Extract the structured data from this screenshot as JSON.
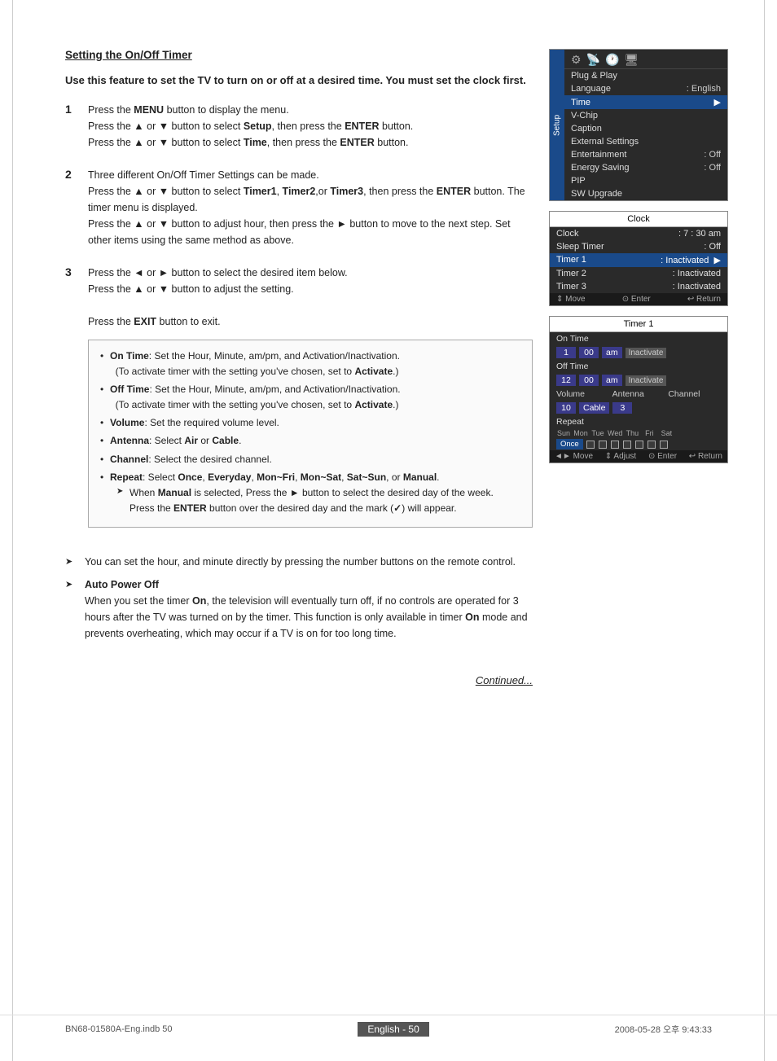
{
  "page": {
    "title": "Setting the On/Off Timer",
    "intro": "Use this feature to set the TV to turn on or off at a desired time. You must set the clock first.",
    "steps": [
      {
        "number": "1",
        "content": "Press the <b>MENU</b> button to display the menu.<br>Press the ▲ or ▼ button to select <b>Setup</b>, then press the <b>ENTER</b> button.<br>Press the ▲ or ▼ button to select <b>Time</b>, then press the <b>ENTER</b> button."
      },
      {
        "number": "2",
        "content": "Three different On/Off Timer Settings can be made.<br>Press the ▲ or ▼ button to select <b>Timer1</b>, <b>Timer2</b>, or <b>Timer3</b>, then press the <b>ENTER</b> button. The timer menu is displayed.<br>Press the ▲ or ▼ button to adjust hour, then press the ► button to move to the next step. Set other items using the same method as above."
      },
      {
        "number": "3",
        "content": "Press the ◄ or ► button to select the desired item below.<br>Press the ▲ or ▼ button to adjust the setting.<br><br>Press the <b>EXIT</b> button to exit."
      }
    ],
    "infobox": {
      "items": [
        "On Time: Set the Hour, Minute, am/pm, and Activation/Inactivation. (To activate timer with the setting you've chosen, set to Activate.)",
        "Off Time: Set the Hour, Minute, am/pm, and Activation/Inactivation. (To activate timer with the setting you've chosen, set to Activate.)",
        "Volume: Set the required volume level.",
        "Antenna: Select Air or Cable.",
        "Channel: Select the desired channel.",
        "Repeat: Select Once, Everyday, Mon~Fri, Mon~Sat, Sat~Sun, or Manual."
      ],
      "subItem": "When Manual is selected, Press the ► button to select the desired day of the week. Press the ENTER button over the desired day and the mark (✓) will appear."
    },
    "notes": [
      "You can set the hour, and minute directly by pressing the number buttons on the remote control.",
      "Auto Power Off\nWhen you set the timer On, the television will eventually turn off, if no controls are operated for 3 hours after the TV was turned on by the timer. This function is only available in timer On mode and prevents overheating, which may occur if a TV is on for too long time."
    ],
    "continued": "Continued...",
    "footer": {
      "file": "BN68-01580A-Eng.indb   50",
      "date": "2008-05-28   오후 9:43:33",
      "page_label": "English - 50"
    }
  },
  "menus": {
    "setup_menu": {
      "title": "Setup",
      "items": [
        {
          "label": "Plug & Play",
          "value": ""
        },
        {
          "label": "Language",
          "value": ": English"
        },
        {
          "label": "Time",
          "value": "",
          "highlighted": true
        },
        {
          "label": "V-Chip",
          "value": ""
        },
        {
          "label": "Caption",
          "value": ""
        },
        {
          "label": "External Settings",
          "value": ""
        },
        {
          "label": "Entertainment",
          "value": ": Off"
        },
        {
          "label": "Energy Saving",
          "value": ": Off"
        },
        {
          "label": "PIP",
          "value": ""
        },
        {
          "label": "SW Upgrade",
          "value": ""
        }
      ]
    },
    "clock_menu": {
      "title": "Clock",
      "items": [
        {
          "label": "Clock",
          "value": ": 7 : 30 am"
        },
        {
          "label": "Sleep Timer",
          "value": ": Off"
        },
        {
          "label": "Timer 1",
          "value": ": Inactivated",
          "highlighted": true,
          "arrow": true
        },
        {
          "label": "Timer 2",
          "value": ": Inactivated"
        },
        {
          "label": "Timer 3",
          "value": ": Inactivated"
        }
      ],
      "footer": "⇕ Move   ⊙ Enter   ↩ Return"
    },
    "timer1_menu": {
      "title": "Timer 1",
      "on_time_label": "On Time",
      "on_time_hour": "1",
      "on_time_min": "00",
      "on_time_ampm": "am",
      "on_time_btn": "Inactivate",
      "off_time_label": "Off Time",
      "off_time_hour": "12",
      "off_time_min": "00",
      "off_time_ampm": "am",
      "off_time_btn": "Inactivate",
      "volume_label": "Volume",
      "antenna_label": "Antenna",
      "channel_label": "Channel",
      "volume_val": "10",
      "antenna_val": "Cable",
      "channel_val": "3",
      "repeat_label": "Repeat",
      "days": [
        "Sun",
        "Mon",
        "Tue",
        "Wed",
        "Thu",
        "Fri",
        "Sat"
      ],
      "once_btn": "Once",
      "footer": "◄► Move   ⇕ Adjust   ⊙ Enter   ↩ Return"
    }
  }
}
